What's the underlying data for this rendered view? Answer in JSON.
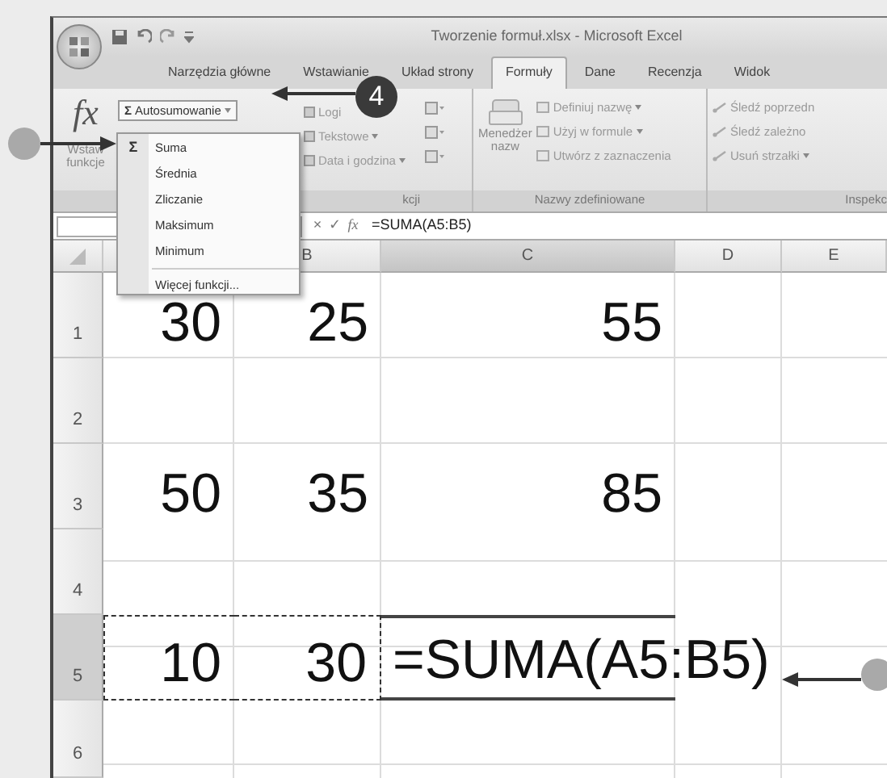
{
  "window": {
    "title": "Tworzenie formuł.xlsx - Microsoft Excel"
  },
  "tabs": [
    {
      "label": "Narzędzia główne",
      "selected": false
    },
    {
      "label": "Wstawianie",
      "selected": false
    },
    {
      "label": "Układ strony",
      "selected": false
    },
    {
      "label": "Formuły",
      "selected": true
    },
    {
      "label": "Dane",
      "selected": false
    },
    {
      "label": "Recenzja",
      "selected": false
    },
    {
      "label": "Widok",
      "selected": false
    }
  ],
  "ribbon": {
    "library": {
      "insert_function": {
        "icon": "fx",
        "label": [
          "Wstaw",
          "funkcje"
        ]
      },
      "autosum": {
        "icon": "Σ",
        "label": "Autosumowanie",
        "dropdown": true
      },
      "buttons": [
        {
          "label": "Logi",
          "dropdown": false
        },
        {
          "label": "Tekstowe",
          "dropdown": true
        },
        {
          "label": "Data i godzina",
          "dropdown": true
        }
      ],
      "group_label": "kcji"
    },
    "names": {
      "manager": [
        "Menedżer",
        "nazw"
      ],
      "buttons": [
        {
          "label": "Definiuj nazwę",
          "dropdown": true
        },
        {
          "label": "Użyj w formule",
          "dropdown": true
        },
        {
          "label": "Utwórz z zaznaczenia",
          "dropdown": false
        }
      ],
      "group_label": "Nazwy zdefiniowane"
    },
    "auditing": {
      "buttons": [
        {
          "label": "Śledź poprzedn",
          "dropdown": false
        },
        {
          "label": "Śledź zależno",
          "dropdown": false
        },
        {
          "label": "Usuń strzałki",
          "dropdown": true
        }
      ],
      "group_label": "Inspekc"
    }
  },
  "autosum_menu": {
    "items": [
      {
        "kind": "function",
        "icon": "Σ",
        "label": "Suma"
      },
      {
        "kind": "function",
        "label": "Średnia"
      },
      {
        "kind": "function",
        "label": "Zliczanie"
      },
      {
        "kind": "function",
        "label": "Maksimum"
      },
      {
        "kind": "function",
        "label": "Minimum"
      },
      {
        "kind": "more",
        "label": "Więcej funkcji..."
      }
    ]
  },
  "formula_bar": {
    "cancel": "×",
    "enter": "✓",
    "fx": "fx",
    "formula": "=SUMA(A5:B5)"
  },
  "sheet": {
    "columns": [
      {
        "selected": false
      },
      {
        "label": "B",
        "selected": false
      },
      {
        "label": "C",
        "selected": true
      },
      {
        "label": "D",
        "selected": false
      },
      {
        "label": "E",
        "selected": false
      }
    ],
    "rows": [
      {
        "header": "1",
        "selected": false,
        "cells": [
          {
            "text": "30",
            "marquee": false,
            "editing": false
          },
          {
            "text": "25",
            "marquee": false,
            "editing": false
          },
          {
            "text": "55",
            "marquee": false,
            "editing": false
          },
          null,
          null
        ]
      },
      {
        "header": "2",
        "selected": false,
        "cells": [
          null,
          null,
          null,
          null,
          null
        ]
      },
      {
        "header": "3",
        "selected": false,
        "cells": [
          {
            "text": "50",
            "marquee": false,
            "editing": false
          },
          {
            "text": "35",
            "marquee": false,
            "editing": false
          },
          {
            "text": "85",
            "marquee": false,
            "editing": false
          },
          null,
          null
        ]
      },
      {
        "header": "4",
        "selected": false,
        "cells": [
          null,
          null,
          null,
          null,
          null
        ]
      },
      {
        "header": "5",
        "selected": true,
        "cells": [
          {
            "text": "10",
            "marquee": true,
            "editing": false
          },
          {
            "text": "30",
            "marquee": true,
            "editing": false
          },
          {
            "text": "=SUMA(A5:B5)",
            "marquee": false,
            "editing": true
          },
          null,
          null
        ]
      },
      {
        "header": "6",
        "selected": false,
        "cells": [
          null,
          null,
          null,
          null,
          null
        ]
      }
    ]
  },
  "callouts": [
    {
      "kind": "numbered",
      "label": "4"
    },
    {
      "kind": "dot"
    },
    {
      "kind": "dot"
    }
  ]
}
